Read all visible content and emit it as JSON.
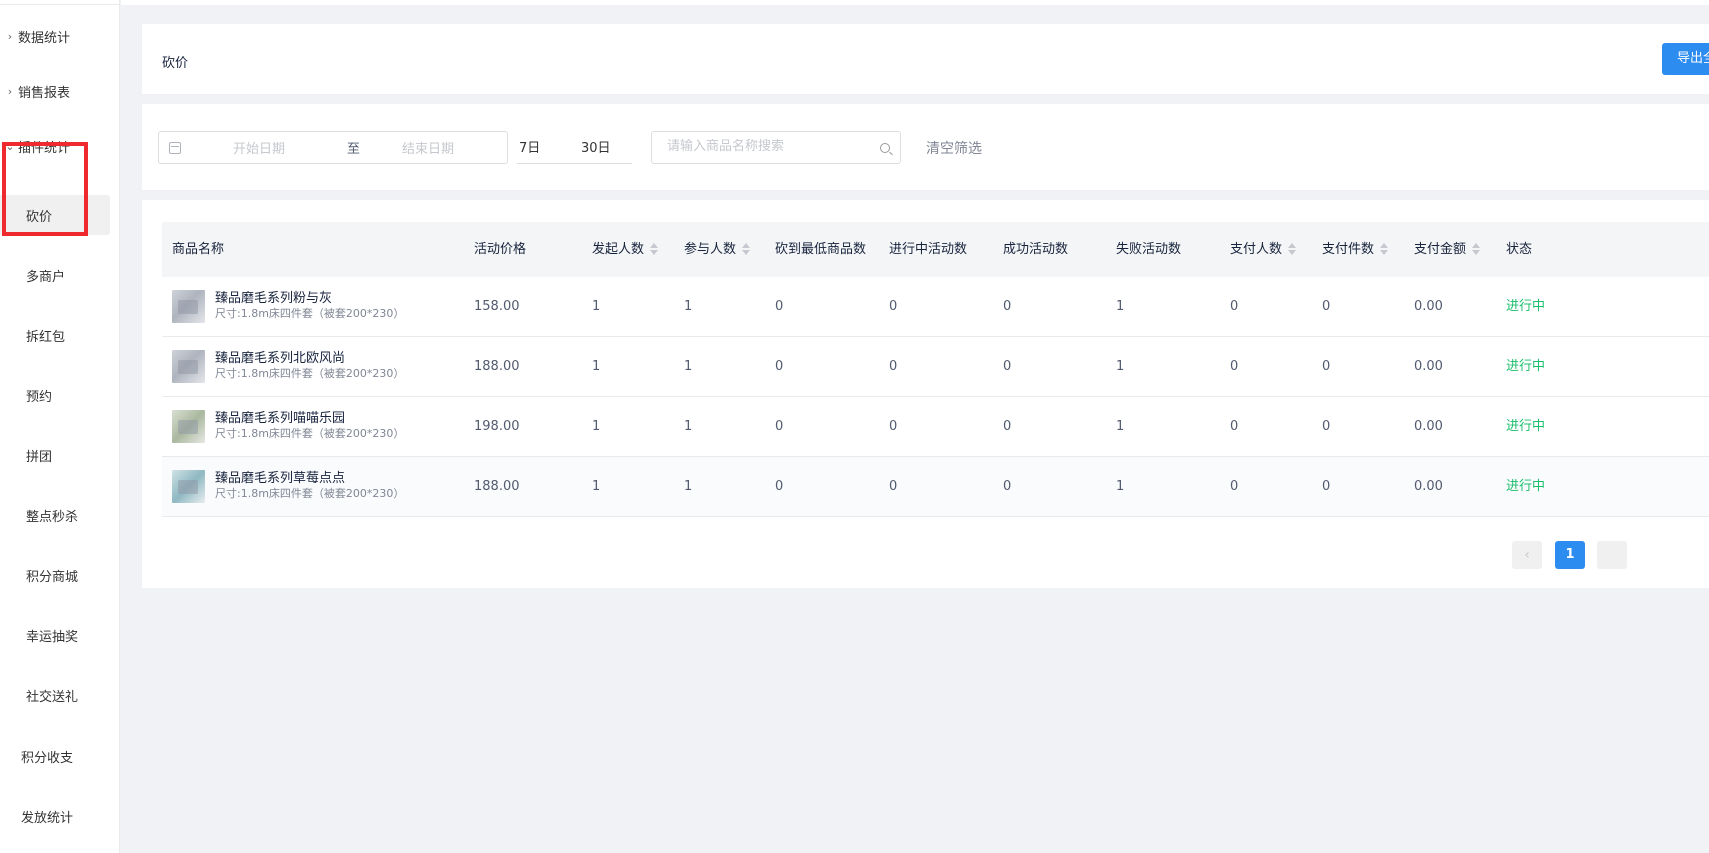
{
  "sidebar": {
    "items": [
      {
        "label": "数据统计",
        "chevron": "›"
      },
      {
        "label": "销售报表",
        "chevron": "›"
      },
      {
        "label": "插件统计",
        "chevron": "⌄"
      }
    ],
    "sub_items": [
      {
        "label": "砍价",
        "active": true
      },
      {
        "label": "多商户"
      },
      {
        "label": "拆红包"
      },
      {
        "label": "预约"
      },
      {
        "label": "拼团"
      },
      {
        "label": "整点秒杀"
      },
      {
        "label": "积分商城"
      },
      {
        "label": "幸运抽奖"
      },
      {
        "label": "社交送礼"
      }
    ],
    "bottom_items": [
      {
        "label": "积分收支"
      },
      {
        "label": "发放统计"
      }
    ]
  },
  "header": {
    "title": "砍价",
    "export_label": "导出全部"
  },
  "filter": {
    "date_start_placeholder": "开始日期",
    "date_to": "至",
    "date_end_placeholder": "结束日期",
    "quick_7": "7日",
    "quick_30": "30日",
    "search_placeholder": "请输入商品名称搜索",
    "clear_label": "清空筛选"
  },
  "table": {
    "columns": [
      "商品名称",
      "活动价格",
      "发起人数",
      "参与人数",
      "砍到最低商品数",
      "进行中活动数",
      "成功活动数",
      "失败活动数",
      "支付人数",
      "支付件数",
      "支付金额",
      "状态"
    ],
    "rows": [
      {
        "name": "臻品磨毛系列粉与灰",
        "spec": "尺寸:1.8m床四件套（被套200*230）",
        "price": "158.00",
        "initiators": "1",
        "participants": "1",
        "lowest": "0",
        "ongoing": "0",
        "success": "0",
        "failed": "1",
        "pay_users": "0",
        "pay_items": "0",
        "pay_amount": "0.00",
        "status": "进行中"
      },
      {
        "name": "臻品磨毛系列北欧风尚",
        "spec": "尺寸:1.8m床四件套（被套200*230）",
        "price": "188.00",
        "initiators": "1",
        "participants": "1",
        "lowest": "0",
        "ongoing": "0",
        "success": "0",
        "failed": "1",
        "pay_users": "0",
        "pay_items": "0",
        "pay_amount": "0.00",
        "status": "进行中"
      },
      {
        "name": "臻品磨毛系列喵喵乐园",
        "spec": "尺寸:1.8m床四件套（被套200*230）",
        "price": "198.00",
        "initiators": "1",
        "participants": "1",
        "lowest": "0",
        "ongoing": "0",
        "success": "0",
        "failed": "1",
        "pay_users": "0",
        "pay_items": "0",
        "pay_amount": "0.00",
        "status": "进行中"
      },
      {
        "name": "臻品磨毛系列草莓点点",
        "spec": "尺寸:1.8m床四件套（被套200*230）",
        "price": "188.00",
        "initiators": "1",
        "participants": "1",
        "lowest": "0",
        "ongoing": "0",
        "success": "0",
        "failed": "1",
        "pay_users": "0",
        "pay_items": "0",
        "pay_amount": "0.00",
        "status": "进行中"
      }
    ]
  },
  "pagination": {
    "prev": "‹",
    "current": "1"
  },
  "colors": {
    "primary": "#2d8cf0",
    "success": "#19be6b",
    "highlight": "#ee2a2f"
  }
}
